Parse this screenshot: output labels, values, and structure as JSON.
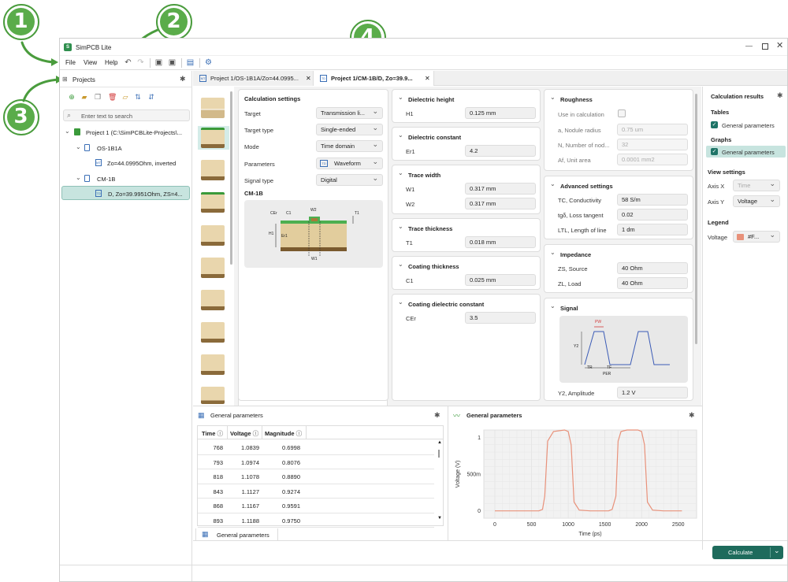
{
  "app": {
    "title": "SimPCB Lite",
    "menu": [
      "File",
      "View",
      "Help"
    ]
  },
  "callouts": [
    "1",
    "2",
    "3",
    "4"
  ],
  "projects_panel": {
    "title": "Projects",
    "search_placeholder": "Enter text to search",
    "tree": [
      "Project 1 (C:\\SimPCBLite-Projects\\...",
      "OS-1B1A",
      "Zo=44.0995Ohm, inverted",
      "CM-1B",
      "D, Zo=39.9951Ohm, ZS=4..."
    ]
  },
  "tabs": [
    {
      "label": "Project 1/OS-1B1A/Zo=44.0995...",
      "icon": "MT"
    },
    {
      "label": "Project 1/CM-1B/D, Zo=39.9...",
      "icon": "TD"
    }
  ],
  "calc_settings": {
    "title": "Calculation settings",
    "rows": [
      {
        "label": "Target",
        "value": "Transmission li..."
      },
      {
        "label": "Target type",
        "value": "Single-ended"
      },
      {
        "label": "Mode",
        "value": "Time domain"
      },
      {
        "label": "Parameters",
        "value": "Waveform",
        "badge": "TD"
      },
      {
        "label": "Signal type",
        "value": "Digital"
      }
    ],
    "structure_name": "CM-1B",
    "diagram_labels": [
      "CEr",
      "C1",
      "W2",
      "T1",
      "H1",
      "Er1",
      "W1"
    ]
  },
  "params": {
    "dielectric_height": {
      "title": "Dielectric height",
      "H1": "0.125 mm"
    },
    "dielectric_constant": {
      "title": "Dielectric constant",
      "Er1": "4.2"
    },
    "trace_width": {
      "title": "Trace width",
      "W1": "0.317 mm",
      "W2": "0.317 mm"
    },
    "trace_thickness": {
      "title": "Trace thickness",
      "T1": "0.018 mm"
    },
    "coating_thickness": {
      "title": "Coating thickness",
      "C1": "0.025 mm"
    },
    "coating_dielectric": {
      "title": "Coating dielectric constant",
      "CEr": "3.5"
    }
  },
  "roughness": {
    "title": "Roughness",
    "use": "Use in calculation",
    "radius_label": "a, Nodule radius",
    "radius": "0.75 um",
    "nodules_label": "N, Number of nod...",
    "nodules": "32",
    "area_label": "Af, Unit area",
    "area": "0.0001 mm2"
  },
  "advanced": {
    "title": "Advanced settings",
    "tc_label": "TC, Conductivity",
    "tc": "58 S/m",
    "tan_label": "tgδ, Loss tangent",
    "tan": "0.02",
    "ltl_label": "LTL, Length of line",
    "ltl": "1 dm"
  },
  "impedance": {
    "title": "Impedance",
    "zs_label": "ZS, Source",
    "zs": "40 Ohm",
    "zl_label": "ZL, Load",
    "zl": "40 Ohm"
  },
  "signal": {
    "title": "Signal",
    "y2_label": "Y2, Amplitude",
    "y2": "1.2 V",
    "diagram_labels": [
      "PW",
      "Y2",
      "TR",
      "TF",
      "PER"
    ]
  },
  "results": {
    "title": "Calculation results",
    "tables_title": "Tables",
    "tables_item": "General parameters",
    "graphs_title": "Graphs",
    "graphs_item": "General parameters",
    "view_title": "View settings",
    "axis_x_label": "Axis X",
    "axis_x": "Time",
    "axis_y_label": "Axis Y",
    "axis_y": "Voltage",
    "legend_title": "Legend",
    "legend_label": "Voltage",
    "legend_value": "#F...",
    "colors": {
      "legend_swatch": "#e8917a"
    }
  },
  "table_panel": {
    "title": "General parameters",
    "bottom_tab": "General parameters",
    "columns": [
      "Time",
      "Voltage",
      "Magnitude"
    ],
    "rows": [
      [
        "768",
        "1.0839",
        "0.6998"
      ],
      [
        "793",
        "1.0974",
        "0.8076"
      ],
      [
        "818",
        "1.1078",
        "0.8890"
      ],
      [
        "843",
        "1.1127",
        "0.9274"
      ],
      [
        "868",
        "1.1167",
        "0.9591"
      ],
      [
        "893",
        "1.1188",
        "0.9750"
      ]
    ]
  },
  "graph_panel": {
    "title": "General parameters"
  },
  "calculate_button": "Calculate",
  "chart_data": {
    "type": "line",
    "xlabel": "Time (ps)",
    "ylabel": "Voltage (V)",
    "xlim": [
      -150,
      2750
    ],
    "ylim": [
      -0.1,
      1.1
    ],
    "xticks": [
      "0",
      "500",
      "1000",
      "1500",
      "2000",
      "2500"
    ],
    "yticks": [
      "0",
      "500m",
      "1"
    ],
    "color": "#e8917a",
    "x": [
      0,
      600,
      650,
      680,
      720,
      800,
      950,
      1000,
      1040,
      1080,
      1150,
      1300,
      1550,
      1600,
      1650,
      1680,
      1720,
      1800,
      1950,
      2000,
      2040,
      2080,
      2150,
      2300,
      2550
    ],
    "y": [
      0,
      0,
      0.02,
      0.2,
      0.95,
      1.08,
      1.1,
      1.08,
      0.9,
      0.12,
      0.01,
      0,
      0,
      0.02,
      0.2,
      0.95,
      1.08,
      1.1,
      1.1,
      1.08,
      0.9,
      0.12,
      0.01,
      0,
      0
    ]
  }
}
